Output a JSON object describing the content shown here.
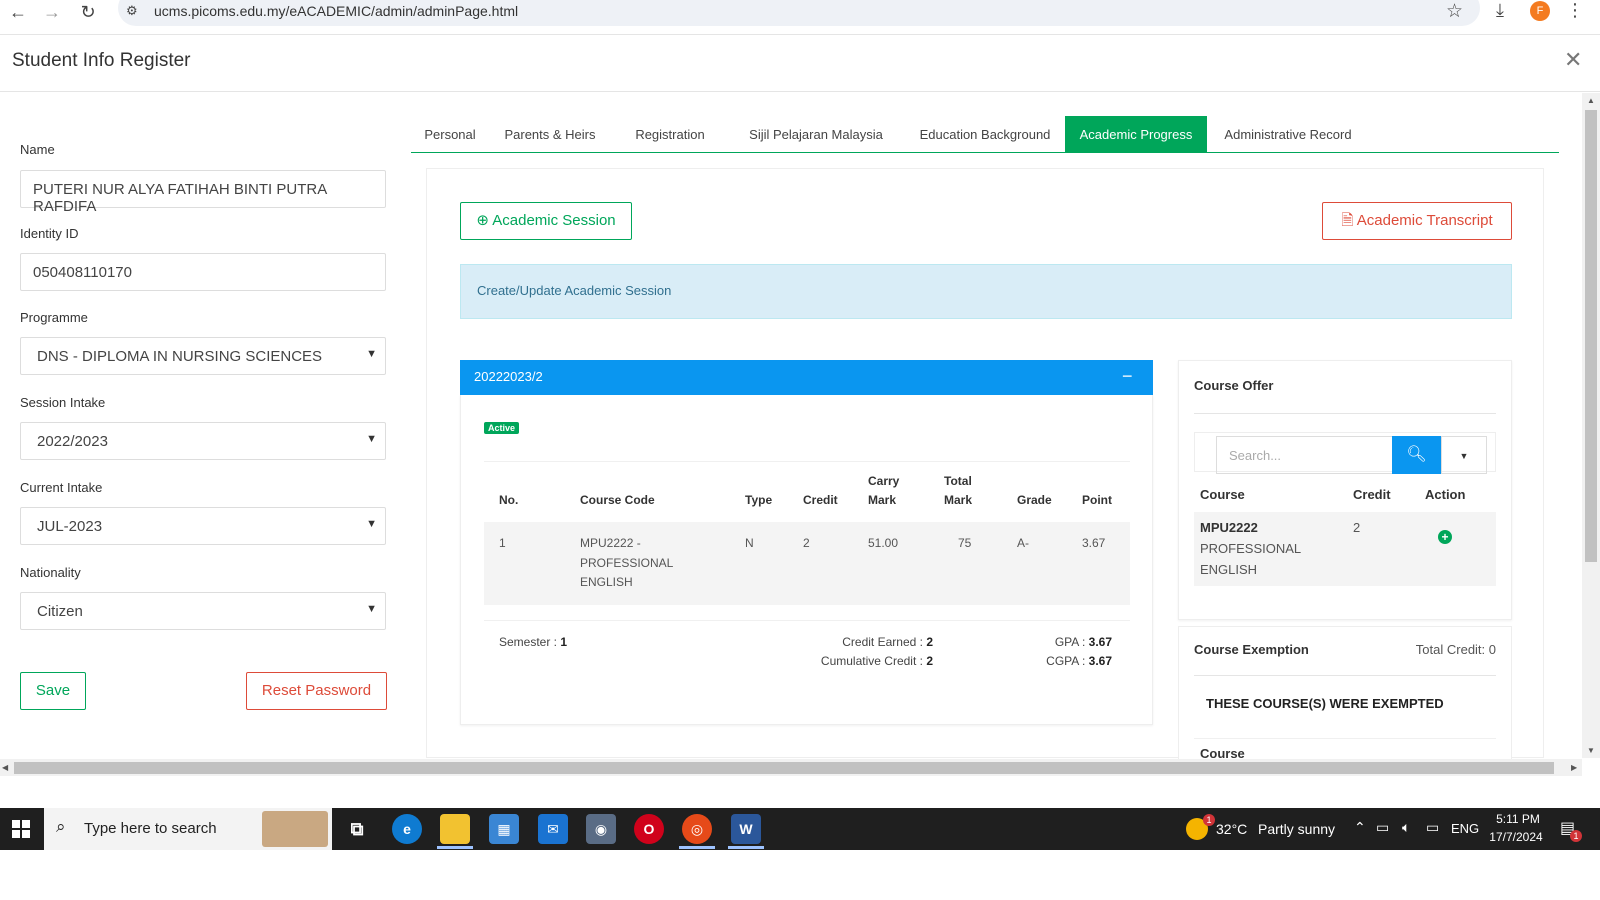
{
  "browser": {
    "url": "ucms.picoms.edu.my/eACADEMIC/admin/adminPage.html",
    "profile_initial": "F"
  },
  "modal": {
    "title": "Student Info Register"
  },
  "form": {
    "name_label": "Name",
    "name_value": "PUTERI NUR ALYA FATIHAH BINTI PUTRA RAFDIFA",
    "identity_label": "Identity ID",
    "identity_value": "050408110170",
    "programme_label": "Programme",
    "programme_value": "DNS - DIPLOMA IN NURSING SCIENCES",
    "session_label": "Session Intake",
    "session_value": "2022/2023",
    "current_label": "Current Intake",
    "current_value": "JUL-2023",
    "nationality_label": "Nationality",
    "nationality_value": "Citizen",
    "save_label": "Save",
    "reset_label": "Reset Password"
  },
  "tabs": [
    {
      "label": "Personal"
    },
    {
      "label": "Parents & Heirs"
    },
    {
      "label": "Registration"
    },
    {
      "label": "Sijil Pelajaran Malaysia"
    },
    {
      "label": "Education Background"
    },
    {
      "label": "Academic Progress",
      "active": true
    },
    {
      "label": "Administrative Record"
    }
  ],
  "academic": {
    "session_button": "Academic Session",
    "transcript_button": "Academic Transcript",
    "info_text": "Create/Update Academic Session",
    "session_title": "20222023/2",
    "status_badge": "Active",
    "headers": {
      "no": "No.",
      "code": "Course Code",
      "type": "Type",
      "credit": "Credit",
      "carry_1": "Carry",
      "carry_2": "Mark",
      "total_1": "Total",
      "total_2": "Mark",
      "grade": "Grade",
      "point": "Point"
    },
    "rows": [
      {
        "no": "1",
        "code_1": "MPU2222 -",
        "code_2": "PROFESSIONAL",
        "code_3": "ENGLISH",
        "type": "N",
        "credit": "2",
        "carry": "51.00",
        "total": "75",
        "grade": "A-",
        "point": "3.67"
      }
    ],
    "footer": {
      "semester_label": "Semester :",
      "semester_value": "1",
      "earned_label": "Credit Earned :",
      "earned_value": "2",
      "cumulative_label": "Cumulative Credit :",
      "cumulative_value": "2",
      "gpa_label": "GPA :",
      "gpa_value": "3.67",
      "cgpa_label": "CGPA :",
      "cgpa_value": "3.67"
    }
  },
  "course_offer": {
    "title": "Course Offer",
    "search_placeholder": "Search...",
    "headers": {
      "course": "Course",
      "credit": "Credit",
      "action": "Action"
    },
    "rows": [
      {
        "code": "MPU2222",
        "name_1": "PROFESSIONAL",
        "name_2": "ENGLISH",
        "credit": "2"
      }
    ]
  },
  "exemption": {
    "title": "Course Exemption",
    "total_credit": "Total Credit: 0",
    "subtitle": "THESE COURSE(S) WERE EXEMPTED",
    "course_header": "Course"
  },
  "taskbar": {
    "search_text": "Type here to search",
    "temperature": "32°C",
    "weather": "Partly sunny",
    "language": "ENG",
    "time": "5:11 PM",
    "date": "17/7/2024",
    "weather_badge": "1",
    "notification_badge": "1"
  },
  "colors": {
    "accent_green": "#00a65a",
    "accent_red": "#dd4b39",
    "accent_blue": "#0a96f0",
    "info_bg": "#d9edf7"
  }
}
